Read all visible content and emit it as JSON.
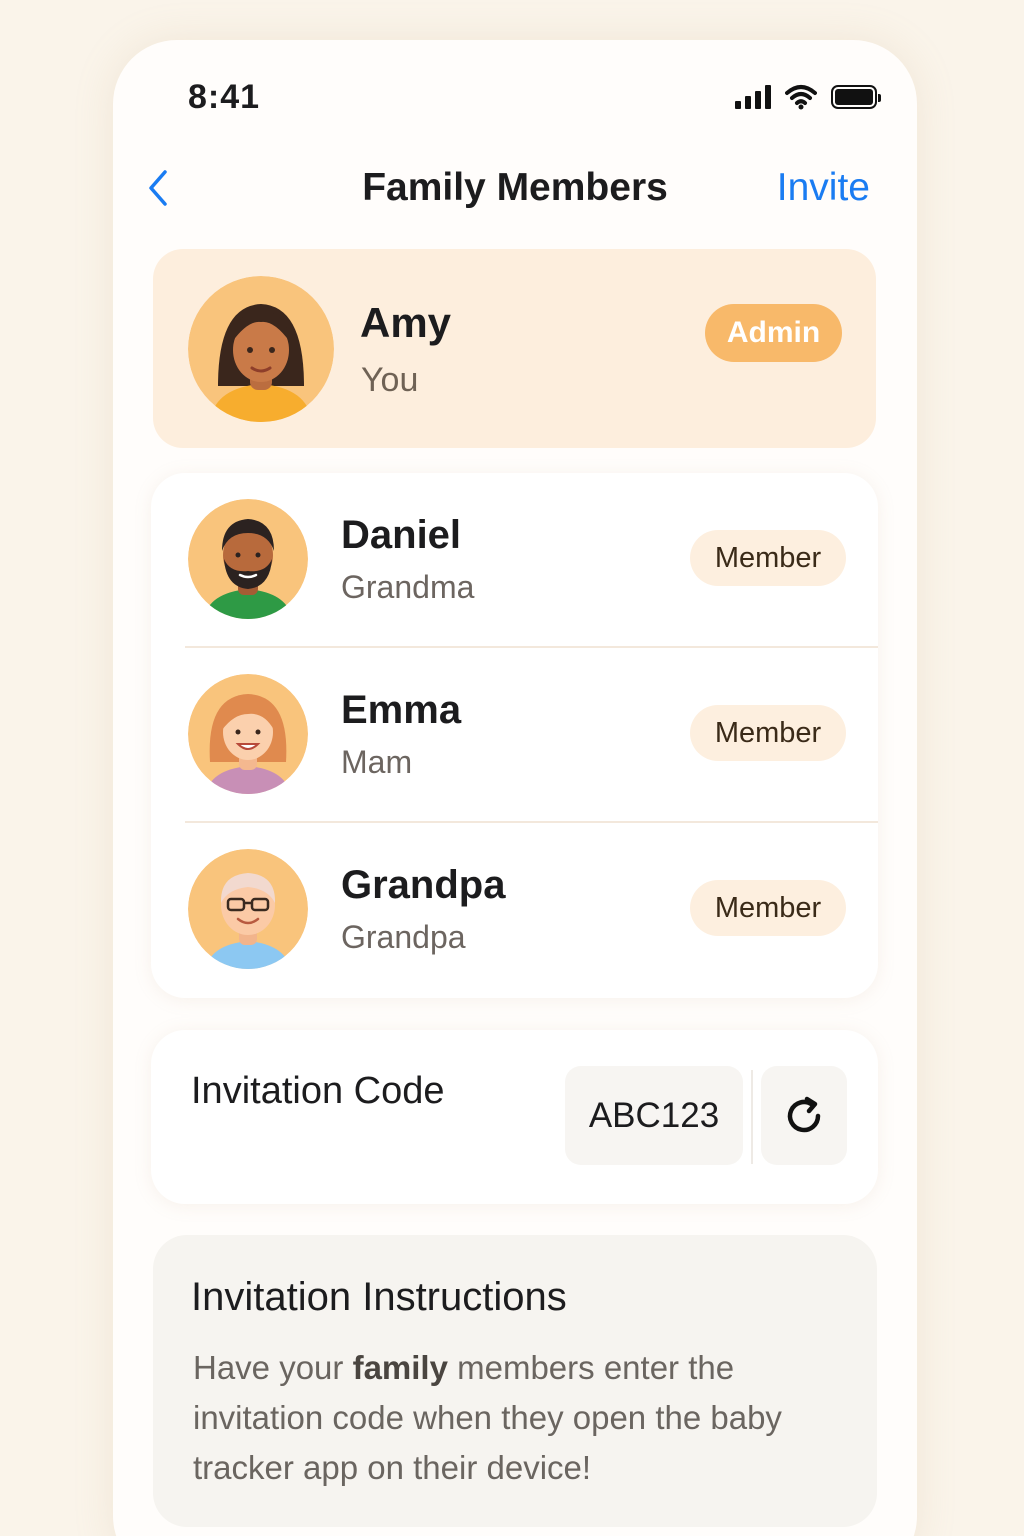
{
  "status_bar": {
    "time": "8:41",
    "icons": [
      "signal-icon",
      "wifi-icon",
      "battery-icon"
    ]
  },
  "nav": {
    "title": "Family Members",
    "action": "Invite",
    "back_icon": "chevron-left-icon"
  },
  "admin": {
    "name": "Amy",
    "subtitle": "You",
    "badge": "Admin"
  },
  "members": [
    {
      "name": "Daniel",
      "role": "Grandma",
      "badge": "Member"
    },
    {
      "name": "Emma",
      "role": "Mam",
      "badge": "Member"
    },
    {
      "name": "Grandpa",
      "role": "Grandpa",
      "badge": "Member"
    }
  ],
  "invitation": {
    "label": "Invitation Code",
    "code": "ABC123",
    "refresh_icon": "refresh-icon"
  },
  "instructions": {
    "title": "Invitation Instructions",
    "text_before": "Have your ",
    "text_bold": "family",
    "text_after": " members enter the invitation code when they open the baby tracker app on their device!"
  },
  "colors": {
    "accent": "#1a7cf2",
    "admin_badge": "#f8b96a",
    "admin_card": "#fdeedd",
    "member_badge": "#fdefdf"
  }
}
